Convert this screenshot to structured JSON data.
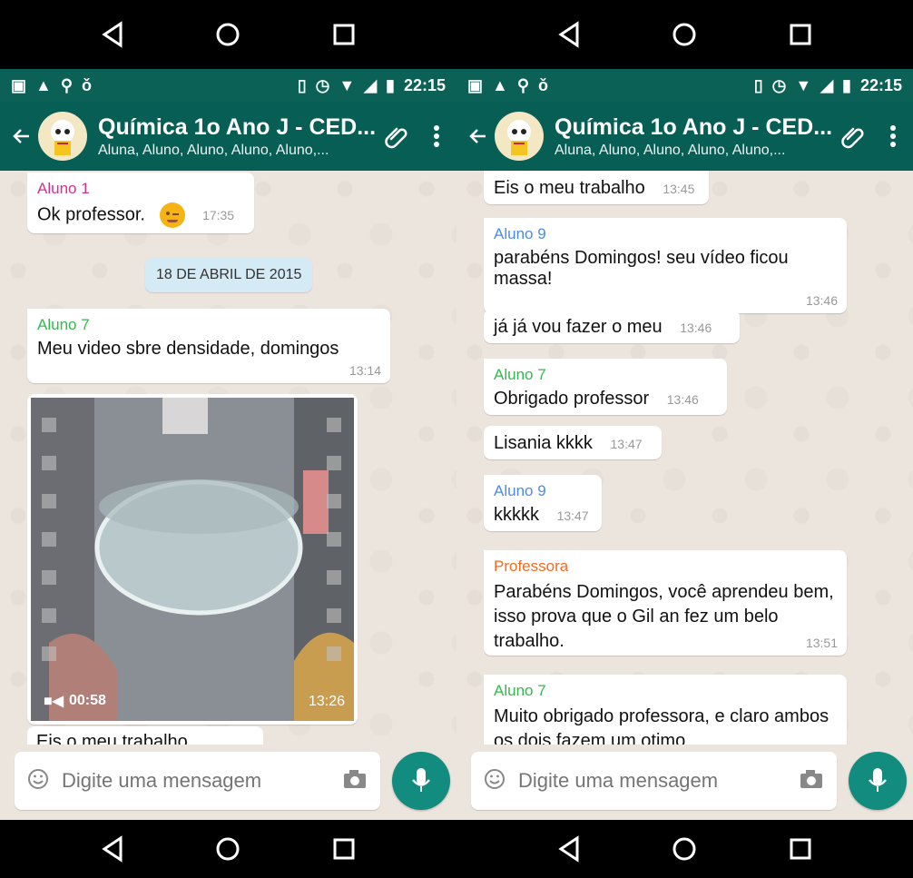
{
  "status": {
    "time": "22:15"
  },
  "chat_header": {
    "title": "Química 1o Ano J - CED...",
    "subtitle": "Aluna, Aluno, Aluno, Aluno, Aluno,..."
  },
  "input": {
    "placeholder": "Digite uma mensagem"
  },
  "left_chat": {
    "date_chip": "18 DE ABRIL DE 2015",
    "messages": [
      {
        "sender": "Aluno 1",
        "text": "Ok professor.",
        "time": "17:35",
        "sender_color": "#d2318f"
      },
      {
        "sender": "Aluno 7",
        "text": "Meu video sbre densidade, domingos",
        "time": "13:14",
        "sender_color": "#35b84e"
      },
      {
        "text": "Eis o meu trabalho"
      }
    ],
    "video": {
      "duration": "00:58",
      "time": "13:26"
    }
  },
  "right_chat": {
    "messages": [
      {
        "text": "Eis o meu trabalho",
        "time": "13:45"
      },
      {
        "sender": "Aluno 9",
        "text": "parabéns Domingos! seu vídeo ficou massa!",
        "time": "13:46",
        "sender_color": "#4d8ce6"
      },
      {
        "text": "já já vou fazer o meu",
        "time": "13:46"
      },
      {
        "sender": "Aluno 7",
        "text": "Obrigado professor",
        "time": "13:46",
        "sender_color": "#35b84e"
      },
      {
        "text": "Lisania kkkk",
        "time": "13:47"
      },
      {
        "sender": "Aluno 9",
        "text": "kkkkk",
        "time": "13:47",
        "sender_color": "#4d8ce6"
      },
      {
        "sender": "Professora",
        "text": "Parabéns Domingos, você aprendeu bem, isso prova que o Gil an fez um belo trabalho.",
        "time": "13:51",
        "sender_color": "#f06c1f"
      },
      {
        "sender": "Aluno 7",
        "text": "Muito obrigado professora, e claro ambos os dois fazem um otimo",
        "sender_color": "#35b84e"
      }
    ]
  }
}
